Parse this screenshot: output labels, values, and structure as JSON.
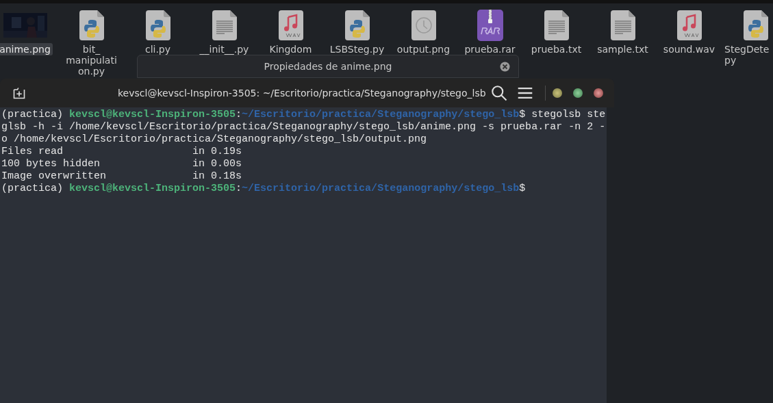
{
  "files": [
    {
      "lines": [
        "anime.png"
      ],
      "kind": "picture",
      "selected": true
    },
    {
      "lines": [
        "bit_",
        "manipulati",
        "on.py"
      ],
      "kind": "python",
      "selected": false
    },
    {
      "lines": [
        "cli.py"
      ],
      "kind": "python",
      "selected": false
    },
    {
      "lines": [
        "__init__.py"
      ],
      "kind": "text",
      "selected": false
    },
    {
      "lines": [
        "Kingdom"
      ],
      "kind": "audio",
      "selected": false
    },
    {
      "lines": [
        "LSBSteg.py"
      ],
      "kind": "python",
      "selected": false
    },
    {
      "lines": [
        "output.png"
      ],
      "kind": "clock",
      "selected": false
    },
    {
      "lines": [
        "prueba.rar"
      ],
      "kind": "archive",
      "selected": false
    },
    {
      "lines": [
        "prueba.txt"
      ],
      "kind": "text",
      "selected": false
    },
    {
      "lines": [
        "sample.txt"
      ],
      "kind": "text",
      "selected": false
    },
    {
      "lines": [
        "sound.wav"
      ],
      "kind": "audio",
      "selected": false
    },
    {
      "lines": [
        "StegDete",
        "py"
      ],
      "kind": "python",
      "selected": false
    }
  ],
  "dialog": {
    "title": "Propiedades de anime.png"
  },
  "terminal": {
    "title": "kevscl@kevscl-Inspiron-3505: ~/Escritorio/practica/Steganography/stego_lsb",
    "lines": [
      [
        {
          "text": "(practica) ",
          "kind": "plain"
        },
        {
          "text": "kevscl@kevscl-Inspiron-3505",
          "kind": "user"
        },
        {
          "text": ":",
          "kind": "plain"
        },
        {
          "text": "~/Escritorio/practica/Steganography/stego_lsb",
          "kind": "path"
        },
        {
          "text": "$ stegolsb ste",
          "kind": "plain"
        }
      ],
      [
        {
          "text": "glsb -h -i /home/kevscl/Escritorio/practica/Steganography/stego_lsb/anime.png -s prueba.rar -n 2 -",
          "kind": "plain"
        }
      ],
      [
        {
          "text": "o /home/kevscl/Escritorio/practica/Steganography/stego_lsb/output.png",
          "kind": "plain"
        }
      ],
      [
        {
          "text": "Files read                     in 0.19s",
          "kind": "plain"
        }
      ],
      [
        {
          "text": "100 bytes hidden               in 0.00s",
          "kind": "plain"
        }
      ],
      [
        {
          "text": "Image overwritten              in 0.18s",
          "kind": "plain"
        }
      ],
      [
        {
          "text": "(practica) ",
          "kind": "plain"
        },
        {
          "text": "kevscl@kevscl-Inspiron-3505",
          "kind": "user"
        },
        {
          "text": ":",
          "kind": "plain"
        },
        {
          "text": "~/Escritorio/practica/Steganography/stego_lsb",
          "kind": "path"
        },
        {
          "text": "$",
          "kind": "plain"
        }
      ]
    ]
  }
}
